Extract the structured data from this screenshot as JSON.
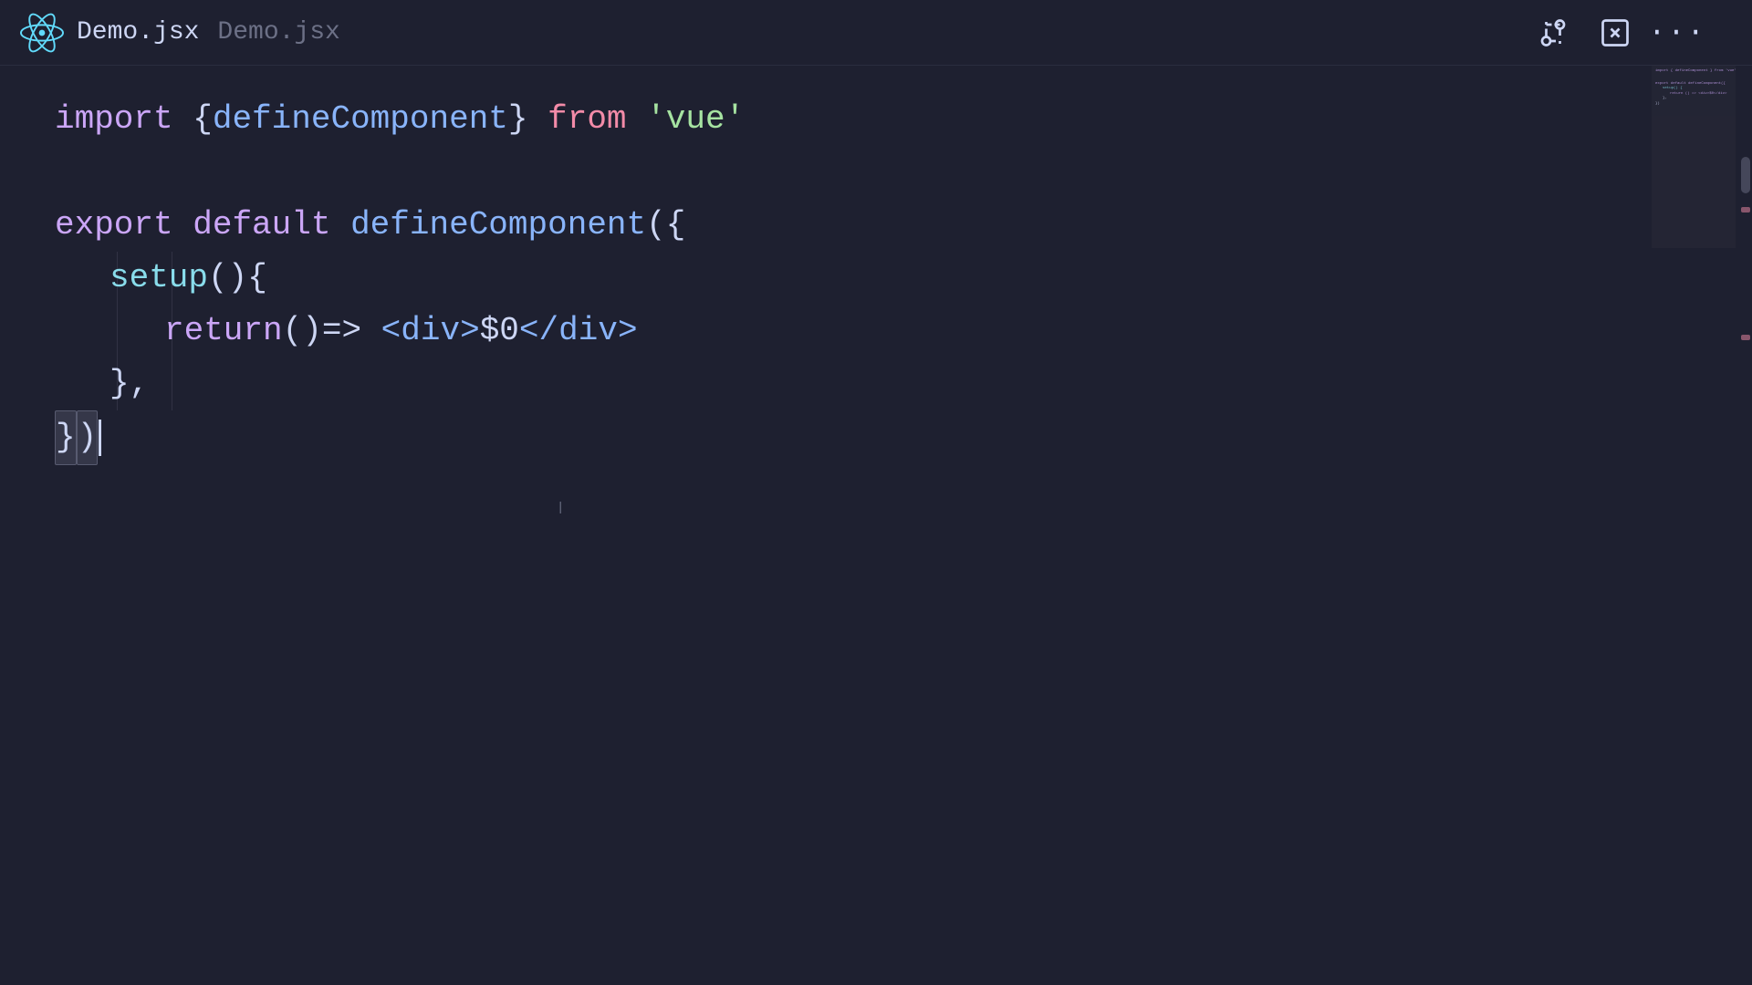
{
  "header": {
    "tab_active": "Demo.jsx",
    "tab_inactive": "Demo.jsx",
    "logo_alt": "React Logo"
  },
  "toolbar": {
    "diff_icon": "⇄",
    "close_icon": "✕",
    "more_icon": "..."
  },
  "code": {
    "line1": {
      "import": "import",
      "brace_open": "{ ",
      "define_component": "defineComponent",
      "brace_close": " }",
      "from": "from",
      "module": "'vue'"
    },
    "line2_empty": "",
    "line3": {
      "export": "export",
      "default": "default",
      "define_component": "defineComponent",
      "paren_open": "(",
      "brace_open": "{"
    },
    "line4": {
      "setup": "setup",
      "parens": "()",
      "brace": " {"
    },
    "line5": {
      "return": "return",
      "paren_open": " (",
      "paren_close": ")",
      "arrow": " =>",
      "div_open": " <div>",
      "placeholder": "$0",
      "div_close": "</div>"
    },
    "line6": {
      "brace_close": "}",
      "comma": ","
    },
    "line7": {
      "brace_close": "}",
      "paren_close": ")"
    }
  }
}
